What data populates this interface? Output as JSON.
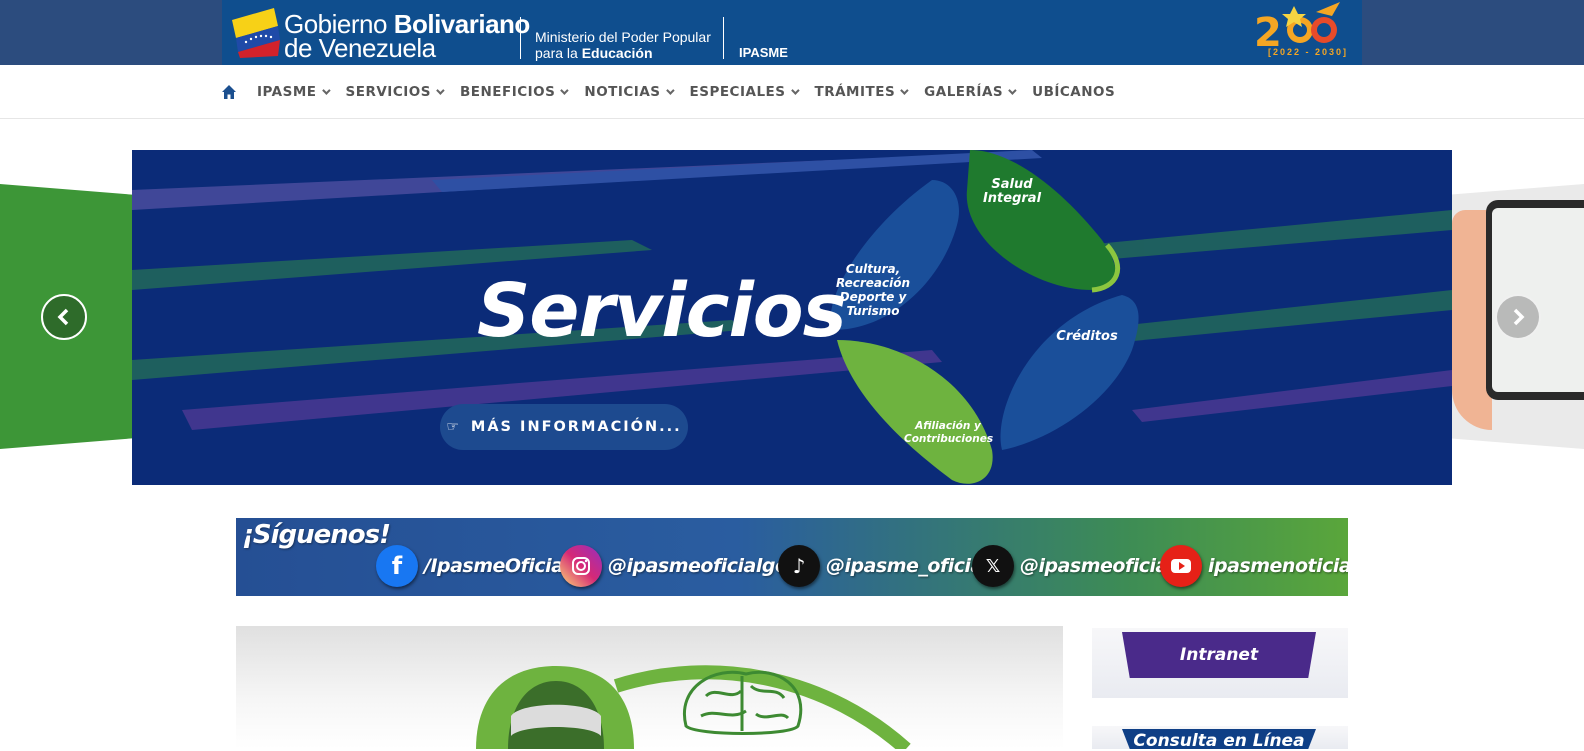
{
  "header": {
    "gov_light": "Gobierno",
    "gov_bold": "Bolivariano",
    "gov_line2": "de Venezuela",
    "ministry_line1": "Ministerio del Poder Popular",
    "ministry_line2_light": "para la",
    "ministry_line2_bold": "Educación",
    "org": "IPASME",
    "logo_years": "[2022 - 2030]",
    "logo_number": "200"
  },
  "nav": {
    "home_icon": "home-icon",
    "items": [
      {
        "label": "IPASME",
        "has_dropdown": true
      },
      {
        "label": "SERVICIOS",
        "has_dropdown": true
      },
      {
        "label": "BENEFICIOS",
        "has_dropdown": true
      },
      {
        "label": "NOTICIAS",
        "has_dropdown": true
      },
      {
        "label": "ESPECIALES",
        "has_dropdown": true
      },
      {
        "label": "TRÁMITES",
        "has_dropdown": true
      },
      {
        "label": "GALERÍAS",
        "has_dropdown": true
      },
      {
        "label": "UBÍCANOS",
        "has_dropdown": false
      }
    ]
  },
  "slider": {
    "title": "Servicios",
    "button_label": "MÁS INFORMACIÓN...",
    "button_icon": "hand-pointer-icon",
    "petals": {
      "salud": "Salud Integral",
      "cultura": "Cultura, Recreación Deporte y Turismo",
      "creditos": "Créditos",
      "afiliacion": "Afiliación y Contribuciones"
    },
    "prev_icon": "chevron-left-icon",
    "next_icon": "chevron-right-icon"
  },
  "social": {
    "title": "¡Síguenos!",
    "items": [
      {
        "network": "facebook-icon",
        "handle": "/IpasmeOficial",
        "color": "#1877f2"
      },
      {
        "network": "instagram-icon",
        "handle": "@ipasmeoficialgob",
        "color": "#d62976"
      },
      {
        "network": "tiktok-icon",
        "handle": "@ipasme_oficial",
        "color": "#111111"
      },
      {
        "network": "x-icon",
        "handle": "@ipasmeoficial",
        "color": "#111111"
      },
      {
        "network": "youtube-icon",
        "handle": "ipasmenoticias",
        "color": "#e62117"
      }
    ]
  },
  "sidebar": {
    "intranet": "Intranet",
    "consulta": "Consulta en Línea"
  },
  "colors": {
    "brand_blue": "#0f4e8e",
    "slide_bg": "#0b2b78",
    "green": "#3d9637",
    "purple": "#4a2a8a"
  }
}
